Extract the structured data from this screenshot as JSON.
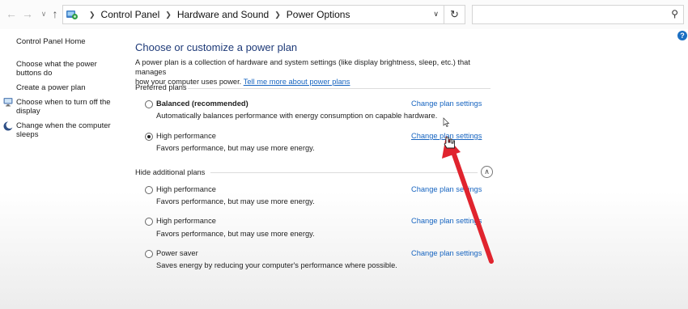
{
  "address_bar": {
    "breadcrumbs": [
      "Control Panel",
      "Hardware and Sound",
      "Power Options"
    ],
    "search_placeholder": ""
  },
  "left_pane": {
    "home_label": "Control Panel Home",
    "links": [
      {
        "label_line1": "Choose what the power",
        "label_line2": "buttons do"
      },
      {
        "label_line1": "Create a power plan",
        "label_line2": ""
      },
      {
        "label_line1": "Choose when to turn off the",
        "label_line2": "display"
      },
      {
        "label_line1": "Change when the computer",
        "label_line2": "sleeps"
      }
    ]
  },
  "main": {
    "title": "Choose or customize a power plan",
    "intro_line1": "A power plan is a collection of hardware and system settings (like display brightness, sleep, etc.) that manages",
    "intro_line2": "how your computer uses power.",
    "intro_link": "Tell me more about power plans",
    "preferred_label": "Preferred plans",
    "hidden_label": "Hide additional plans",
    "change_label": "Change plan settings",
    "preferred_plans": [
      {
        "name": "Balanced (recommended)",
        "desc": "Automatically balances performance with energy consumption on capable hardware.",
        "selected": false
      },
      {
        "name": "High performance",
        "desc": "Favors performance, but may use more energy.",
        "selected": true
      }
    ],
    "additional_plans": [
      {
        "name": "High performance",
        "desc": "Favors performance, but may use more energy.",
        "selected": false
      },
      {
        "name": "High performance",
        "desc": "Favors performance, but may use more energy.",
        "selected": false
      },
      {
        "name": "Power saver",
        "desc": "Saves energy by reducing your computer's performance where possible.",
        "selected": false
      }
    ]
  },
  "annotation": {
    "arrow_color": "#e0242e"
  }
}
